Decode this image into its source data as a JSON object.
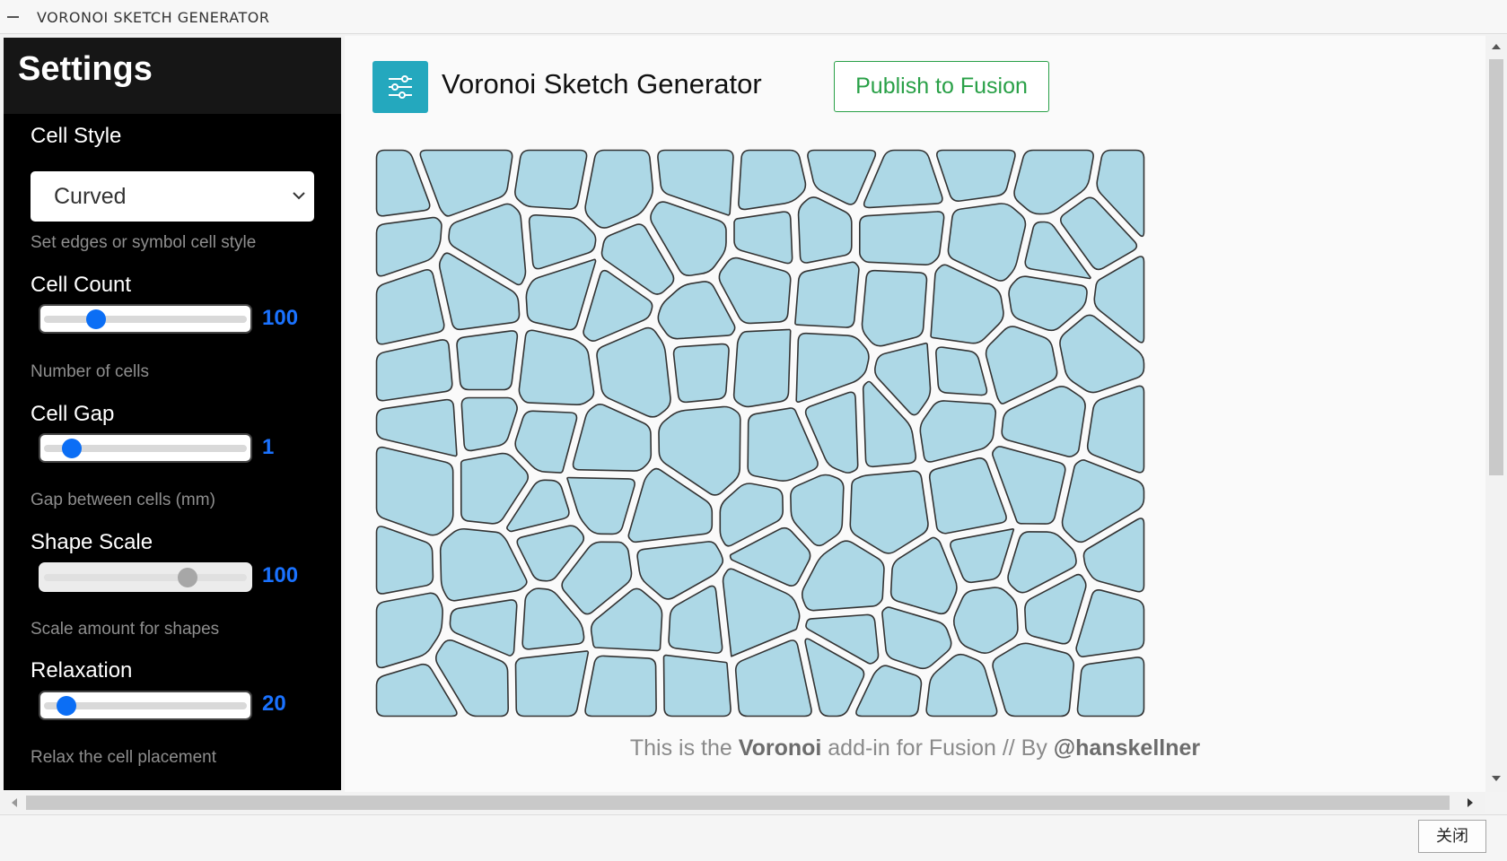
{
  "window": {
    "title": "VORONOI SKETCH GENERATOR"
  },
  "sidebar": {
    "title": "Settings",
    "cell_style": {
      "label": "Cell Style",
      "value": "Curved",
      "helper": "Set edges or symbol cell style"
    },
    "cell_count": {
      "label": "Cell Count",
      "value": "100",
      "fraction": 0.23,
      "helper": "Number of cells"
    },
    "cell_gap": {
      "label": "Cell Gap",
      "value": "1",
      "fraction": 0.1,
      "helper": "Gap between cells (mm)"
    },
    "shape_scale": {
      "label": "Shape Scale",
      "value": "100",
      "fraction": 0.73,
      "helper": "Scale amount for shapes",
      "disabled": true
    },
    "relaxation": {
      "label": "Relaxation",
      "value": "20",
      "fraction": 0.07,
      "helper": "Relax the cell placement"
    }
  },
  "main": {
    "app_icon": "sliders-icon",
    "app_title": "Voronoi Sketch Generator",
    "publish_label": "Publish to Fusion",
    "footer": {
      "prefix": "This is the ",
      "name": "Voronoi",
      "middle": " add-in for Fusion // By ",
      "author": "@hanskellner"
    }
  },
  "dialog": {
    "close_label": "关闭"
  },
  "colors": {
    "cell_fill": "#add8e6",
    "cell_stroke": "#333333",
    "accent": "#1a72ff",
    "publish": "#29a047",
    "icon_bg": "#24a8be"
  }
}
